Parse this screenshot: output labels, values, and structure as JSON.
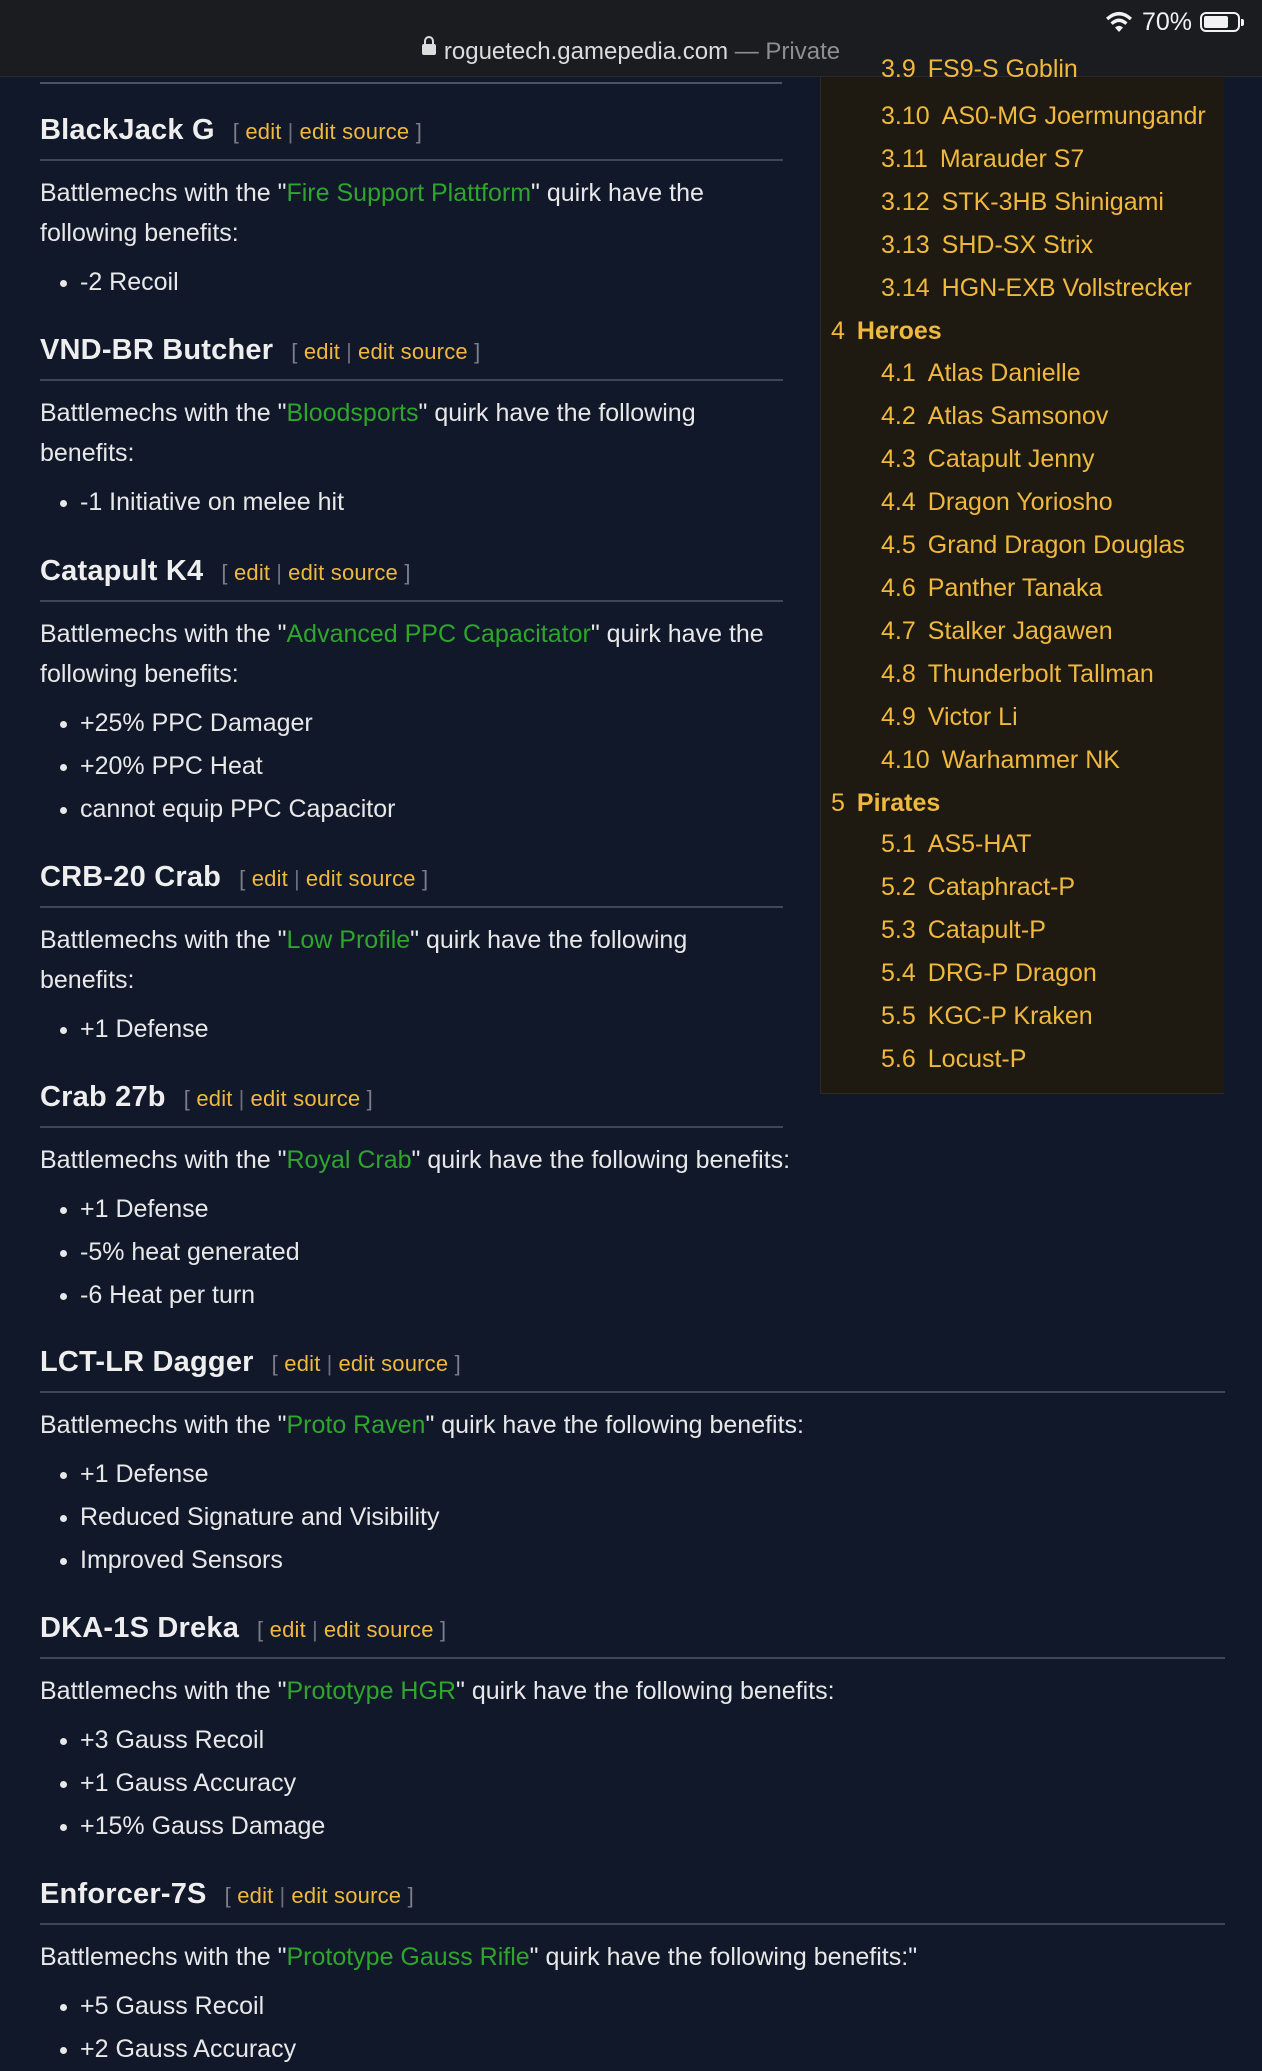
{
  "status_bar": {
    "battery": "70%"
  },
  "browser": {
    "domain": "roguetech.gamepedia.com",
    "mode": "— Private"
  },
  "edit_links": {
    "edit": "edit",
    "edit_source": "edit source",
    "open": "[",
    "close": "]",
    "sep": "|"
  },
  "toc": {
    "items": [
      {
        "num": "3.9",
        "label": "FS9-S Goblin"
      },
      {
        "num": "3.10",
        "label": "AS0-MG Joermungandr"
      },
      {
        "num": "3.11",
        "label": "Marauder S7"
      },
      {
        "num": "3.12",
        "label": "STK-3HB Shinigami"
      },
      {
        "num": "3.13",
        "label": "SHD-SX Strix"
      },
      {
        "num": "3.14",
        "label": "HGN-EXB Vollstrecker"
      }
    ],
    "heroes": {
      "num": "4",
      "label": "Heroes"
    },
    "heroes_items": [
      {
        "num": "4.1",
        "label": "Atlas Danielle"
      },
      {
        "num": "4.2",
        "label": "Atlas Samsonov"
      },
      {
        "num": "4.3",
        "label": "Catapult Jenny"
      },
      {
        "num": "4.4",
        "label": "Dragon Yoriosho"
      },
      {
        "num": "4.5",
        "label": "Grand Dragon Douglas"
      },
      {
        "num": "4.6",
        "label": "Panther Tanaka"
      },
      {
        "num": "4.7",
        "label": "Stalker Jagawen"
      },
      {
        "num": "4.8",
        "label": "Thunderbolt Tallman"
      },
      {
        "num": "4.9",
        "label": "Victor Li"
      },
      {
        "num": "4.10",
        "label": "Warhammer NK"
      }
    ],
    "pirates": {
      "num": "5",
      "label": "Pirates"
    },
    "pirates_items": [
      {
        "num": "5.1",
        "label": "AS5-HAT"
      },
      {
        "num": "5.2",
        "label": "Cataphract-P"
      },
      {
        "num": "5.3",
        "label": "Catapult-P"
      },
      {
        "num": "5.4",
        "label": "DRG-P Dragon"
      },
      {
        "num": "5.5",
        "label": "KGC-P Kraken"
      },
      {
        "num": "5.6",
        "label": "Locust-P"
      }
    ]
  },
  "sections": [
    {
      "title": "BlackJack G",
      "pre": "Battlemechs with the \"",
      "quirk": "Fire Support Plattform",
      "post": "\" quirk have the",
      "post2": "following benefits:",
      "benefits": [
        "-2 Recoil"
      ]
    },
    {
      "title": "VND-BR Butcher",
      "pre": "Battlemechs with the \"",
      "quirk": "Bloodsports",
      "post": "\" quirk have the following",
      "post2": "benefits:",
      "benefits": [
        "-1 Initiative on melee hit"
      ]
    },
    {
      "title": "Catapult K4",
      "pre": "Battlemechs with the \"",
      "quirk": "Advanced PPC Capacitator",
      "post": "\" quirk have the",
      "post2": "following benefits:",
      "benefits": [
        "+25% PPC Damager",
        "+20% PPC Heat",
        "cannot equip PPC Capacitor"
      ]
    },
    {
      "title": "CRB-20 Crab",
      "pre": "Battlemechs with the \"",
      "quirk": "Low Profile",
      "post": "\" quirk have the following",
      "post2": "benefits:",
      "benefits": [
        "+1 Defense"
      ]
    },
    {
      "title": "Crab 27b",
      "pre": "Battlemechs with the \"",
      "quirk": "Royal Crab",
      "post": "\" quirk have the following benefits:",
      "post2": "",
      "benefits": [
        "+1 Defense",
        "-5% heat generated",
        "-6 Heat per turn"
      ]
    },
    {
      "title": "LCT-LR Dagger",
      "pre": "Battlemechs with the \"",
      "quirk": "Proto Raven",
      "post": "\" quirk have the following benefits:",
      "post2": "",
      "benefits": [
        "+1 Defense",
        "Reduced Signature and Visibility",
        "Improved Sensors"
      ]
    },
    {
      "title": "DKA-1S Dreka",
      "pre": "Battlemechs with the \"",
      "quirk": "Prototype HGR",
      "post": "\" quirk have the following benefits:",
      "post2": "",
      "benefits": [
        "+3 Gauss Recoil",
        "+1 Gauss Accuracy",
        "+15% Gauss Damage"
      ]
    },
    {
      "title": "Enforcer-7S",
      "pre": "Battlemechs with the \"",
      "quirk": "Prototype Gauss Rifle",
      "post": "\" quirk have the following benefits:\"",
      "post2": "",
      "benefits": [
        "+5 Gauss Recoil",
        "+2 Gauss Accuracy"
      ]
    }
  ]
}
